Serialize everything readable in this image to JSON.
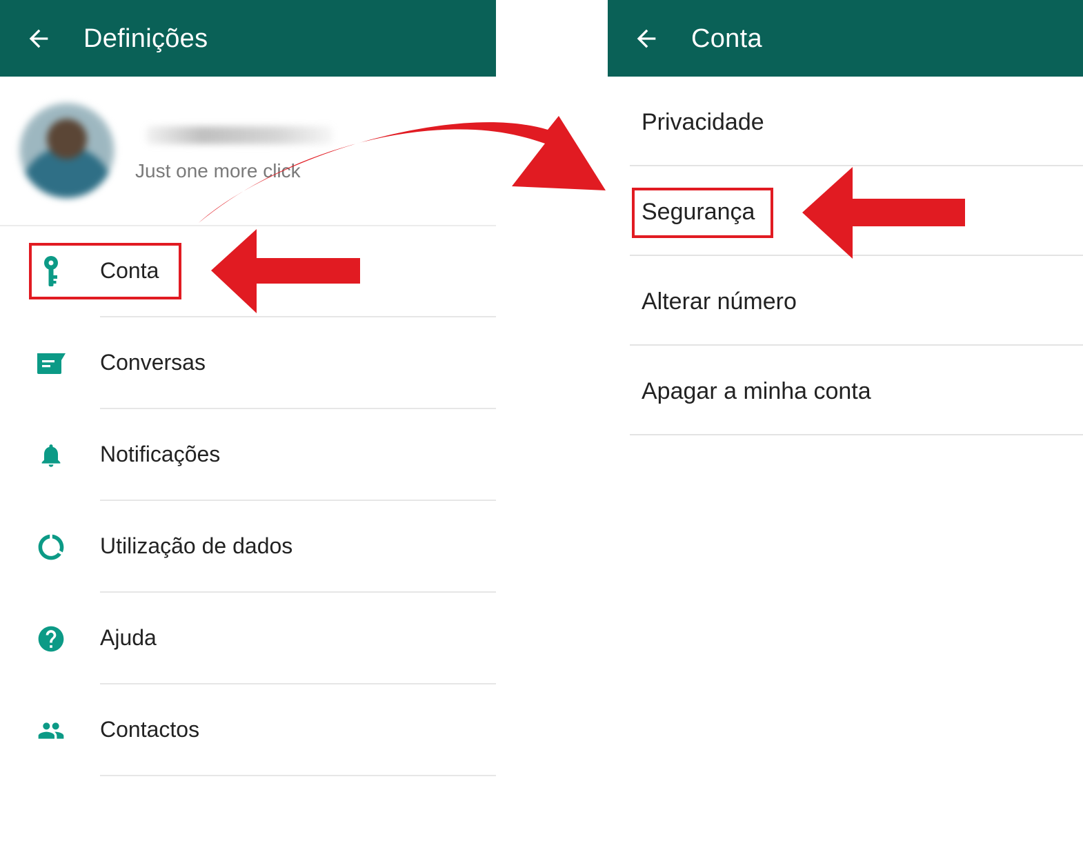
{
  "left_screen": {
    "title": "Definições",
    "profile": {
      "status": "Just one more click"
    },
    "menu": [
      {
        "label": "Conta",
        "icon": "key-icon"
      },
      {
        "label": "Conversas",
        "icon": "chat-icon"
      },
      {
        "label": "Notificações",
        "icon": "bell-icon"
      },
      {
        "label": "Utilização de dados",
        "icon": "data-usage-icon"
      },
      {
        "label": "Ajuda",
        "icon": "help-icon"
      },
      {
        "label": "Contactos",
        "icon": "contacts-icon"
      }
    ]
  },
  "right_screen": {
    "title": "Conta",
    "items": [
      {
        "label": "Privacidade"
      },
      {
        "label": "Segurança"
      },
      {
        "label": "Alterar número"
      },
      {
        "label": "Apagar a minha conta"
      }
    ]
  },
  "colors": {
    "appbar": "#0a6157",
    "icon_teal": "#0c9a86",
    "annotation_red": "#e11b22"
  }
}
